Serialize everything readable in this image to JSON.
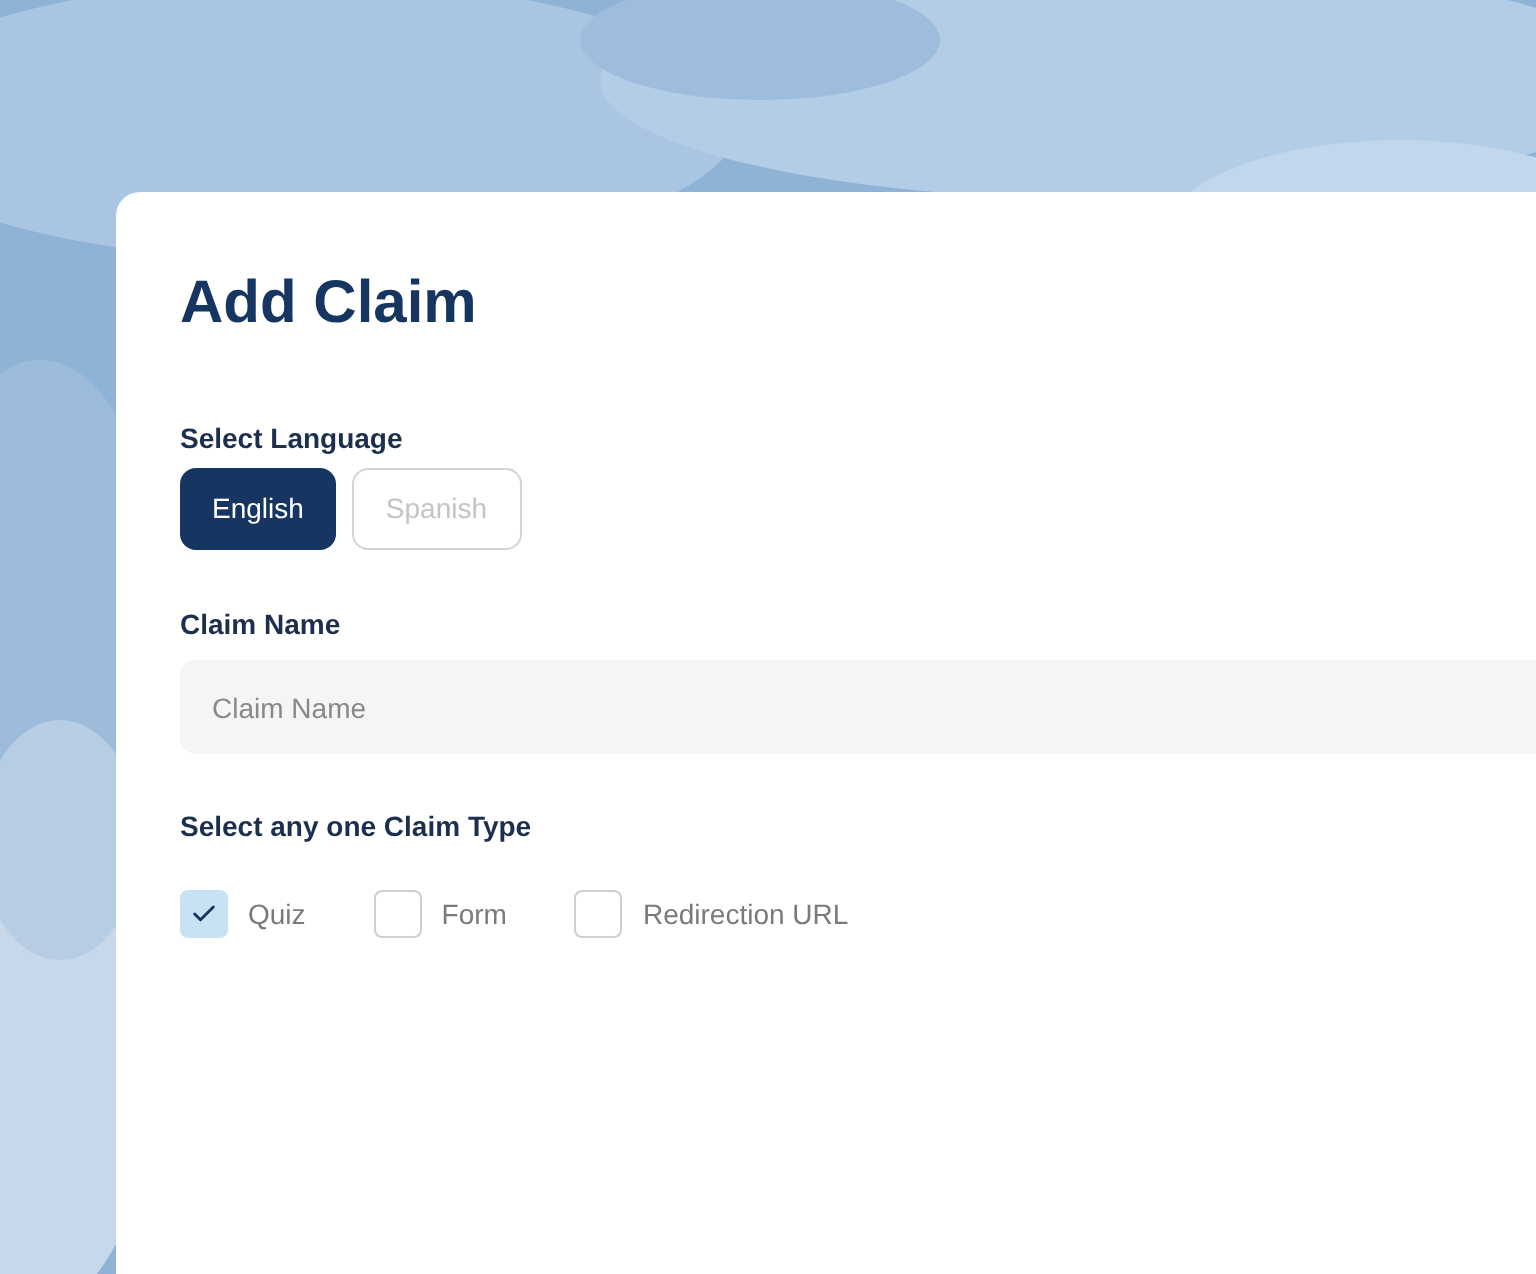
{
  "title": "Add Claim",
  "language": {
    "label": "Select Language",
    "options": [
      {
        "label": "English",
        "selected": true
      },
      {
        "label": "Spanish",
        "selected": false
      }
    ]
  },
  "claim_name": {
    "label": "Claim Name",
    "placeholder": "Claim Name"
  },
  "claim_type": {
    "label": "Select any one Claim Type",
    "options": [
      {
        "label": "Quiz",
        "checked": true
      },
      {
        "label": "Form",
        "checked": false
      },
      {
        "label": "Redirection URL",
        "checked": false
      }
    ]
  }
}
